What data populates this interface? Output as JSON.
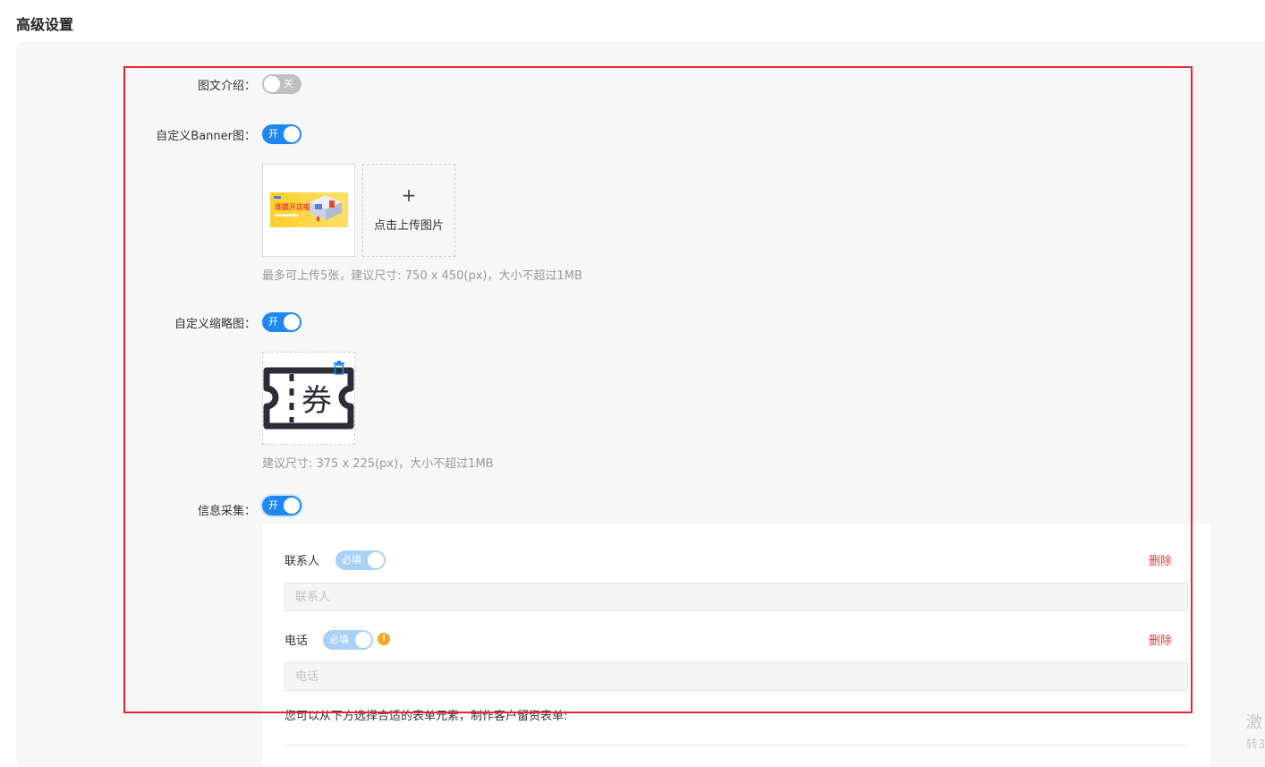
{
  "page": {
    "title": "高级设置"
  },
  "settings": {
    "intro": {
      "label": "图文介绍：",
      "switch_text": "关"
    },
    "banner": {
      "label": "自定义Banner图：",
      "switch_text": "开",
      "upload_icon": "+",
      "upload_text": "点击上传图片",
      "hint": "最多可上传5张，建议尺寸: 750 x 450(px)，大小不超过1MB",
      "image_text": "连锁开店啦"
    },
    "thumbnail": {
      "label": "自定义缩略图：",
      "switch_text": "开",
      "image_glyph": "券",
      "hint": "建议尺寸: 375 x 225(px)，大小不超过1MB"
    },
    "info_collect": {
      "label": "信息采集：",
      "switch_text": "开",
      "fields": [
        {
          "label": "联系人",
          "required_text": "必填",
          "delete_text": "删除",
          "placeholder": "联系人"
        },
        {
          "label": "电话",
          "required_text": "必填",
          "delete_text": "删除",
          "placeholder": "电话",
          "warn_icon": "!"
        }
      ],
      "footer_hint": "您可以从下方选择合适的表单元素，制作客户留资表单:"
    }
  },
  "side": {
    "text1": "激",
    "text2": "转3"
  },
  "colors": {
    "accent": "#1e88f0",
    "danger": "#e53935",
    "highlight": "#e8242a",
    "warning": "#f5a623"
  }
}
